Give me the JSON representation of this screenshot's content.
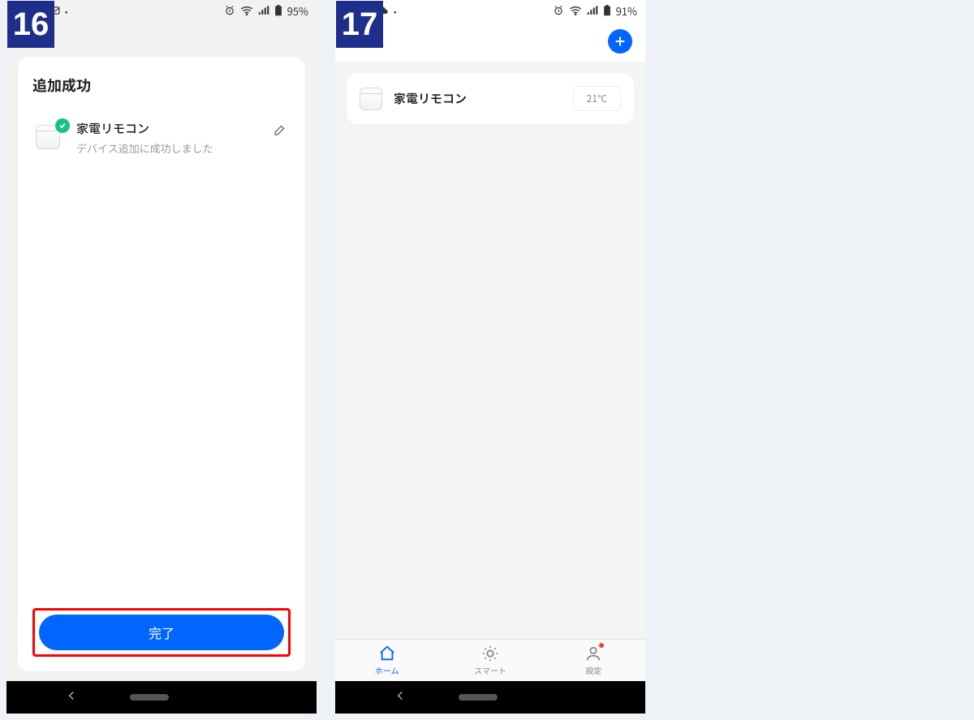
{
  "steps": {
    "left": "16",
    "right": "17"
  },
  "status_left": {
    "battery": "95%"
  },
  "status_right": {
    "battery": "91%"
  },
  "left_screen": {
    "title": "追加成功",
    "device_name": "家電リモコン",
    "device_sub": "デバイス追加に成功しました",
    "done_label": "完了"
  },
  "right_screen": {
    "device_name": "家電リモコン",
    "temperature": "21℃",
    "tabs": {
      "home": "ホーム",
      "smart": "スマート",
      "settings": "設定"
    }
  }
}
